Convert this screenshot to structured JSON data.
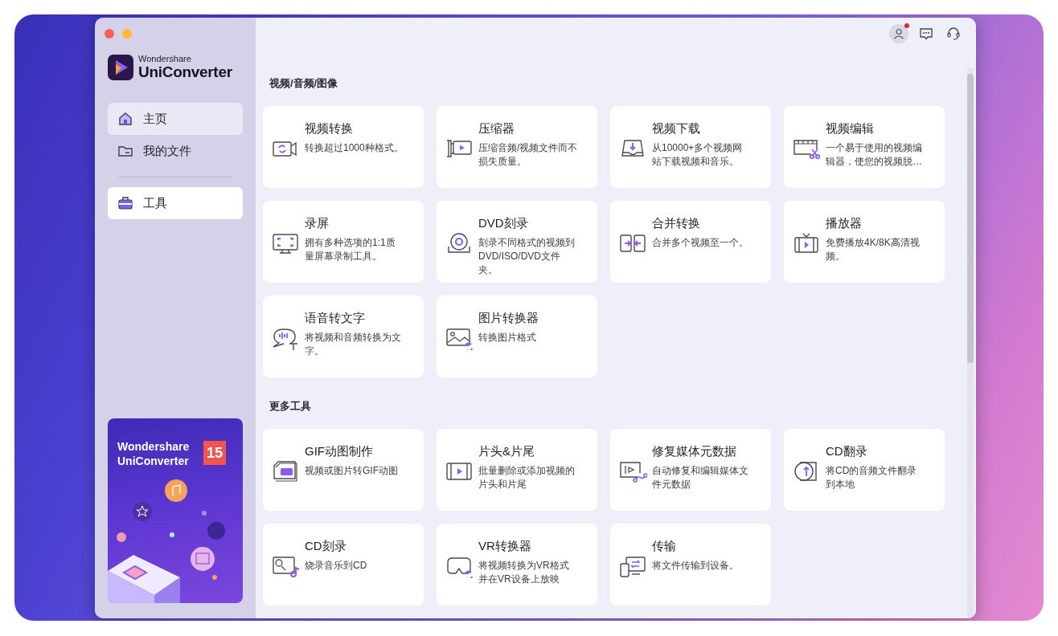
{
  "app": {
    "brand": "Wondershare",
    "product": "UniConverter"
  },
  "sidebar": {
    "items": [
      {
        "label": "主页",
        "selected": false,
        "hovered": true
      },
      {
        "label": "我的文件",
        "selected": false,
        "hovered": false
      },
      {
        "label": "工具",
        "selected": true,
        "hovered": false
      }
    ],
    "promo": {
      "title": "Wondershare UniConverter",
      "version": "15"
    }
  },
  "header": {
    "account": {
      "has_notification": true
    }
  },
  "sections": [
    {
      "title": "视频/音频/图像",
      "tools": [
        {
          "title": "视频转换",
          "description": "转换超过1000种格式。"
        },
        {
          "title": "压缩器",
          "description": "压缩音频/视频文件而不损失质量。"
        },
        {
          "title": "视频下载",
          "description": "从10000+多个视频网站下载视频和音乐。"
        },
        {
          "title": "视频编辑",
          "description": "一个易于使用的视频编辑器，使您的视频脱…"
        },
        {
          "title": "录屏",
          "description": "拥有多种选项的1:1质量屏幕录制工具。"
        },
        {
          "title": "DVD刻录",
          "description": "刻录不同格式的视频到DVD/ISO/DVD文件夹。"
        },
        {
          "title": "合并转换",
          "description": "合并多个视频至一个。"
        },
        {
          "title": "播放器",
          "description": "免费播放4K/8K高清视频。"
        },
        {
          "title": "语音转文字",
          "description": "将视频和音频转换为文字。"
        },
        {
          "title": "图片转换器",
          "description": "转换图片格式"
        }
      ]
    },
    {
      "title": "更多工具",
      "tools": [
        {
          "title": "GIF动图制作",
          "description": "视频或图片转GIF动图"
        },
        {
          "title": "片头&片尾",
          "description": "批量删除或添加视频的片头和片尾"
        },
        {
          "title": "修复媒体元数据",
          "description": "自动修复和编辑媒体文件元数据"
        },
        {
          "title": "CD翻录",
          "description": "将CD的音频文件翻录到本地"
        },
        {
          "title": "CD刻录",
          "description": "烧录音乐到CD"
        },
        {
          "title": "VR转换器",
          "description": "将视频转换为VR格式并在VR设备上放映"
        },
        {
          "title": "传输",
          "description": "将文件传输到设备。"
        }
      ]
    }
  ]
}
